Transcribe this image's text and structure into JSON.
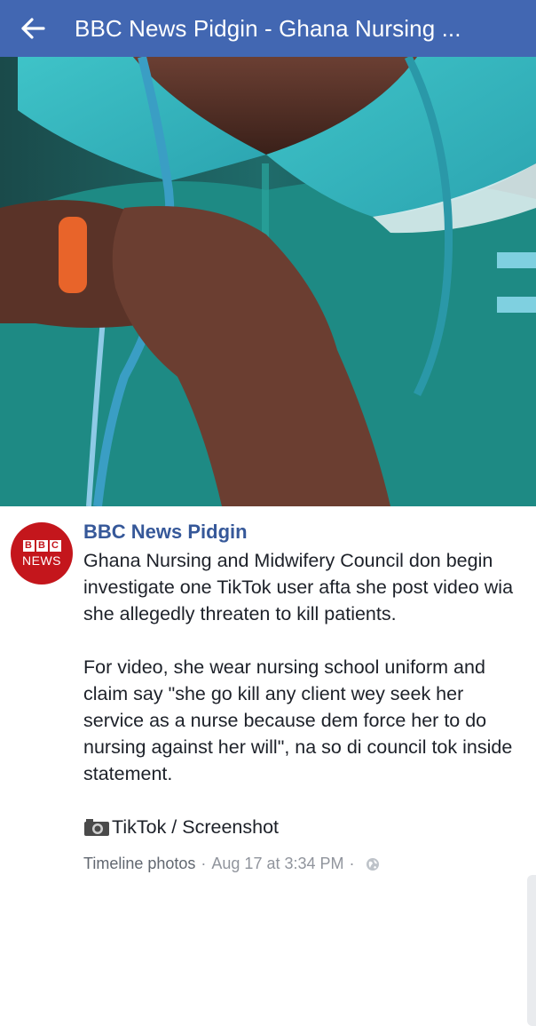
{
  "header": {
    "title": "BBC News Pidgin - Ghana Nursing ...",
    "back_icon": "arrow-left-icon",
    "background": "#4267b2"
  },
  "photo": {
    "subject": "nursing-uniform-stethoscope-photo"
  },
  "post": {
    "avatar": {
      "letters": [
        "B",
        "B",
        "C"
      ],
      "word": "NEWS",
      "color": "#c4161c"
    },
    "page_name": "BBC News Pidgin",
    "paragraph_1": "Ghana Nursing and Midwifery Council don begin investigate one TikTok user afta she post video wia she allegedly threaten to kill patients.",
    "paragraph_2": "For video, she wear nursing school uniform and claim say \"she go kill any client wey seek her service as a nurse because dem force her to do nursing against her will\", na so di council tok inside statement.",
    "caption": "TikTok / Screenshot",
    "caption_icon": "camera-icon",
    "meta": {
      "album": "Timeline photos",
      "separator": "·",
      "timestamp": "Aug 17 at 3:34 PM",
      "privacy_icon": "globe-icon"
    }
  }
}
